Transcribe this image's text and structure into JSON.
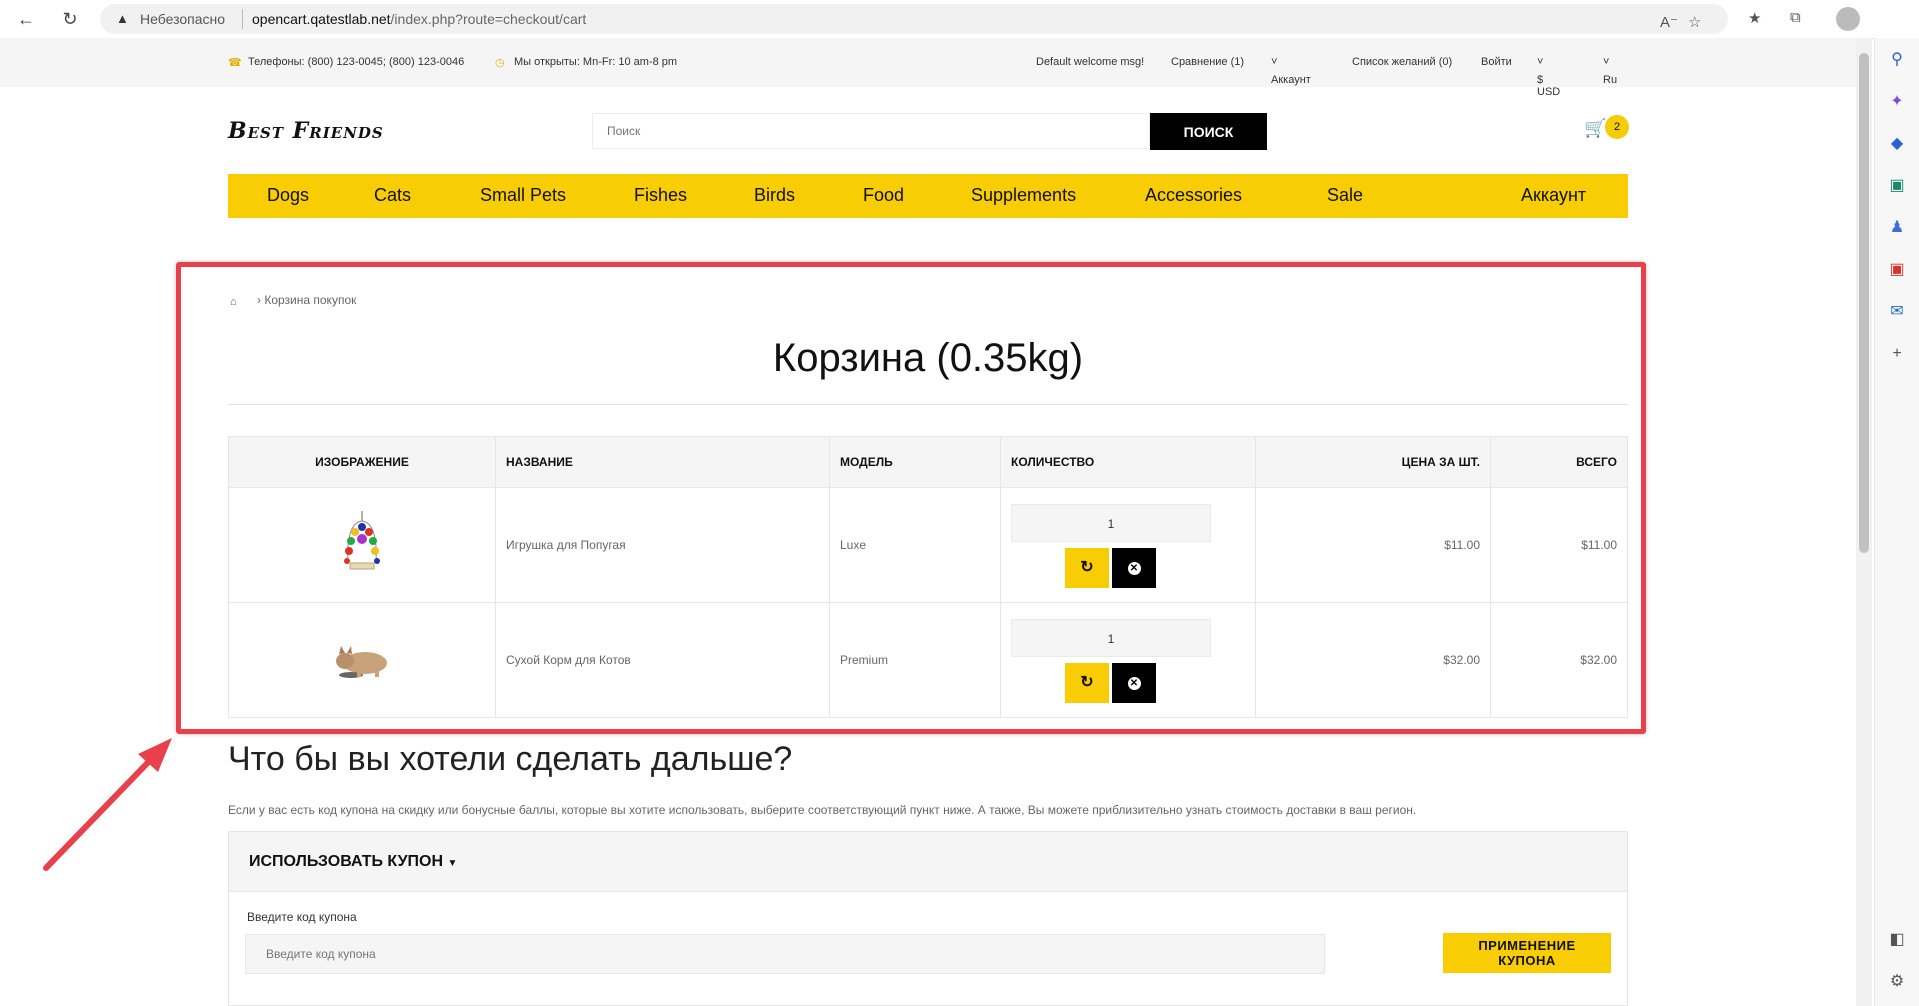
{
  "browser": {
    "insecure_label": "Небезопасно",
    "url_host": "opencart.qatestlab.net",
    "url_path": "/index.php?route=checkout/cart",
    "icons": [
      "back-icon",
      "refresh-icon",
      "read-aloud-icon",
      "favorite-icon",
      "favorites-icon",
      "collections-icon",
      "profile-icon"
    ]
  },
  "topbar": {
    "phones": "Телефоны: (800) 123-0045; (800) 123-0046",
    "hours": "Мы открыты: Mn-Fr: 10 am-8 pm",
    "welcome": "Default welcome msg!",
    "compare": "Сравнение (1)",
    "account": "Аккаунт",
    "wishlist": "Список желаний (0)",
    "login": "Войти",
    "currency": "$ USD",
    "language": "Ru"
  },
  "header": {
    "logo": "Best Friends",
    "search_placeholder": "Поиск",
    "search_button": "ПОИСК",
    "cart_count": "2"
  },
  "menu": {
    "items": [
      "Dogs",
      "Cats",
      "Small Pets",
      "Fishes",
      "Birds",
      "Food",
      "Supplements",
      "Accessories",
      "Sale"
    ],
    "account": "Аккаунт"
  },
  "cart": {
    "breadcrumb": "Корзина покупок",
    "title": "Корзина  (0.35kg)",
    "columns": [
      "Изображение",
      "Название",
      "Модель",
      "Количество",
      "Цена за шт.",
      "Всего"
    ],
    "rows": [
      {
        "name": "Игрушка для Попугая",
        "model": "Luxe",
        "qty": "1",
        "unit_price": "$11.00",
        "total": "$11.00"
      },
      {
        "name": "Сухой Корм для Котов",
        "model": "Premium",
        "qty": "1",
        "unit_price": "$32.00",
        "total": "$32.00"
      }
    ]
  },
  "next": {
    "title": "Что бы вы хотели сделать дальше?",
    "description": "Если у вас есть код купона на скидку или бонусные баллы, которые вы хотите использовать, выберите соответствующий пункт ниже. А также, Вы можете приблизительно узнать стоимость доставки в ваш регион.",
    "coupon_title": "ИСПОЛЬЗОВАТЬ КУПОН",
    "coupon_label": "Введите код купона",
    "coupon_placeholder": "Введите код купона",
    "coupon_button": "ПРИМЕНЕНИЕ КУПОНА"
  },
  "colors": {
    "accent_yellow": "#f9cd04",
    "annotation_red": "#e8414b"
  }
}
